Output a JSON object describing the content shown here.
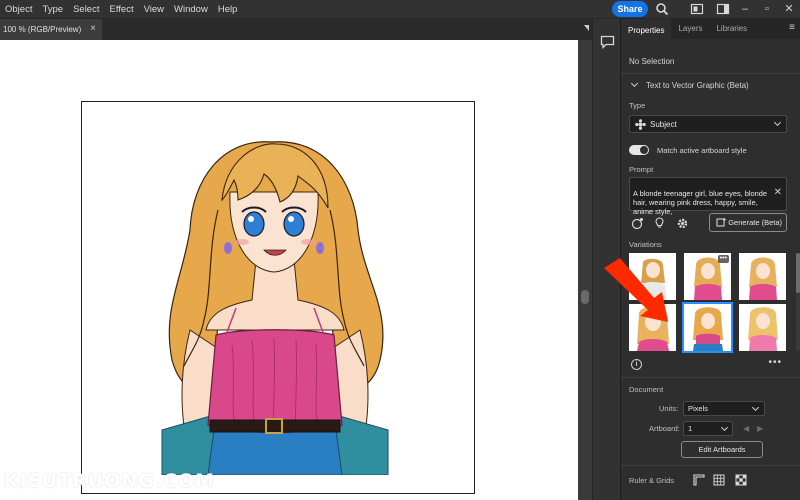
{
  "menubar": {
    "items": [
      "Object",
      "Type",
      "Select",
      "Effect",
      "View",
      "Window",
      "Help"
    ],
    "share_label": "Share",
    "icons": [
      "search-icon",
      "arrange-documents-icon",
      "workspace-icon"
    ],
    "window_controls": [
      "minimize",
      "maximize",
      "close"
    ]
  },
  "document": {
    "tab_title": "100 % (RGB/Preview)",
    "close_symbol": "×"
  },
  "watermark": "KIEUTRUONG.COM",
  "panel": {
    "tabs": [
      "Properties",
      "Layers",
      "Libraries"
    ],
    "active_tab": "Properties",
    "selection_status": "No Selection",
    "section_title": "Text to Vector Graphic (Beta)",
    "type_label": "Type",
    "type_value": "Subject",
    "match_style_label": "Match active artboard style",
    "match_style_on": true,
    "prompt_label": "Prompt",
    "prompt_text": "A blonde teenager girl, blue eyes, blonde hair, wearing pink dress, happy, smile, anime style,",
    "generate_label": "Generate (Beta)",
    "variations_label": "Variations",
    "variations_count": 6,
    "selected_variation": 5,
    "document_label": "Document",
    "units_label": "Units:",
    "units_value": "Pixels",
    "artboard_label": "Artboard:",
    "artboard_value": "1",
    "edit_artboards_label": "Edit Artboards",
    "ruler_grids_label": "Ruler & Grids"
  },
  "colors": {
    "accent": "#1473e6",
    "panel_bg": "#2e2e2e",
    "annotation_arrow": "#ff2a00",
    "selected_outline": "#2b8cff"
  }
}
